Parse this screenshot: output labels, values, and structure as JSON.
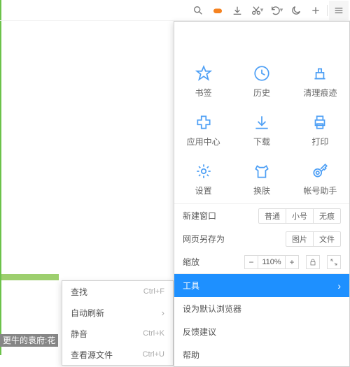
{
  "toolbar": {
    "icons": [
      "search",
      "game",
      "download",
      "cut",
      "undo",
      "moon",
      "plus",
      "menu"
    ]
  },
  "grid": [
    {
      "name": "bookmark",
      "label": "书签"
    },
    {
      "name": "history",
      "label": "历史"
    },
    {
      "name": "clean",
      "label": "清理痕迹"
    },
    {
      "name": "apps",
      "label": "应用中心"
    },
    {
      "name": "downloads",
      "label": "下载"
    },
    {
      "name": "print",
      "label": "打印"
    },
    {
      "name": "settings",
      "label": "设置"
    },
    {
      "name": "skin",
      "label": "换肤"
    },
    {
      "name": "account",
      "label": "帐号助手"
    }
  ],
  "rows": {
    "newwin": {
      "label": "新建窗口",
      "opts": [
        "普通",
        "小号",
        "无痕"
      ]
    },
    "saveas": {
      "label": "网页另存为",
      "opts": [
        "图片",
        "文件"
      ]
    },
    "zoom": {
      "label": "缩放",
      "value": "110%"
    },
    "tools": {
      "label": "工具"
    },
    "setdefault": {
      "label": "设为默认浏览器"
    },
    "feedback": {
      "label": "反馈建议"
    },
    "help": {
      "label": "帮助"
    }
  },
  "submenu": [
    {
      "label": "查找",
      "shortcut": "Ctrl+F"
    },
    {
      "label": "自动刷新",
      "arrow": true
    },
    {
      "label": "静音",
      "shortcut": "Ctrl+K"
    },
    {
      "label": "查看源文件",
      "shortcut": "Ctrl+U"
    }
  ],
  "bottom_tag": "更牛的袁府:花",
  "colors": {
    "accent": "#1e90ff",
    "icon": "#4d9ff5"
  }
}
